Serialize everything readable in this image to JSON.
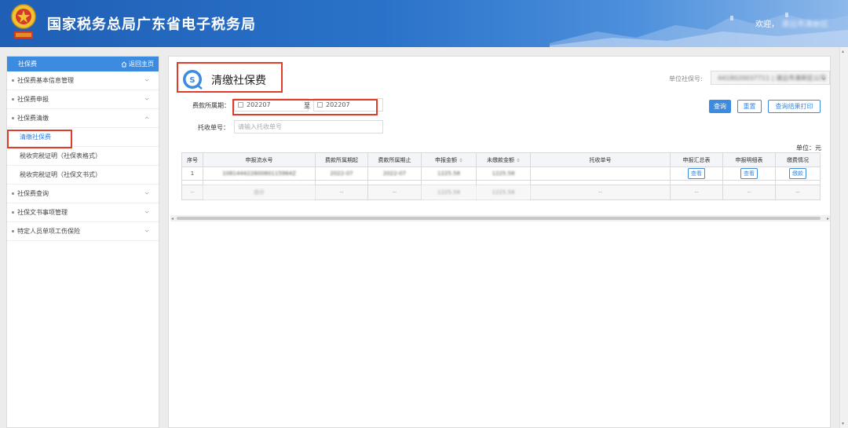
{
  "header": {
    "title": "国家税务总局广东省电子税务局",
    "welcome": "欢迎，",
    "user": "清远市清新区"
  },
  "sidebar": {
    "title": "社保费",
    "home": "返回主页",
    "items": [
      {
        "label": "社保费基本信息管理",
        "expanded": false
      },
      {
        "label": "社保费申报",
        "expanded": false
      },
      {
        "label": "社保费清缴",
        "expanded": true
      },
      {
        "label": "社保费查询",
        "expanded": false
      },
      {
        "label": "社保文书事项管理",
        "expanded": false
      },
      {
        "label": "特定人员单项工伤保险",
        "expanded": false
      }
    ],
    "subitems": [
      "清缴社保费",
      "税收完税证明（社保表格式）",
      "税收完税证明（社保文书式）"
    ]
  },
  "page": {
    "title": "清缴社保费",
    "unit_no_label": "单位社保号:",
    "unit_no_value": "4418020037711 | 清远市清新区公司"
  },
  "form": {
    "period_label": "费款所属期：",
    "period_start": "202207",
    "period_to": "至",
    "period_end": "202207",
    "ticket_label": "托收单号：",
    "ticket_placeholder": "请输入托收单号"
  },
  "buttons": {
    "query": "查询",
    "reset": "重置",
    "print": "查询结果打印"
  },
  "table": {
    "unit": "单位：元",
    "headers": [
      "序号",
      "申报流水号",
      "费款所属期起",
      "费款所属期止",
      "申报金额",
      "未缴款金额",
      "托收单号",
      "申报汇总表",
      "申报明细表",
      "缴费情况"
    ],
    "rows": [
      {
        "index": "1",
        "serial": "10814442280080115964Z",
        "start": "2022-07",
        "end": "2022-07",
        "declared": "1225.58",
        "unpaid": "1225.58",
        "ticket": "",
        "summary_btn": "查看",
        "detail_btn": "查看",
        "pay_btn": "缴款"
      }
    ],
    "total": {
      "index": "--",
      "serial": "合计",
      "start": "--",
      "end": "--",
      "declared": "1225.58",
      "unpaid": "1225.58",
      "ticket": "--",
      "summary": "--",
      "detail": "--",
      "pay": "--"
    }
  },
  "colors": {
    "accent": "#3b8be0",
    "highlight_box": "#e03c2a"
  }
}
